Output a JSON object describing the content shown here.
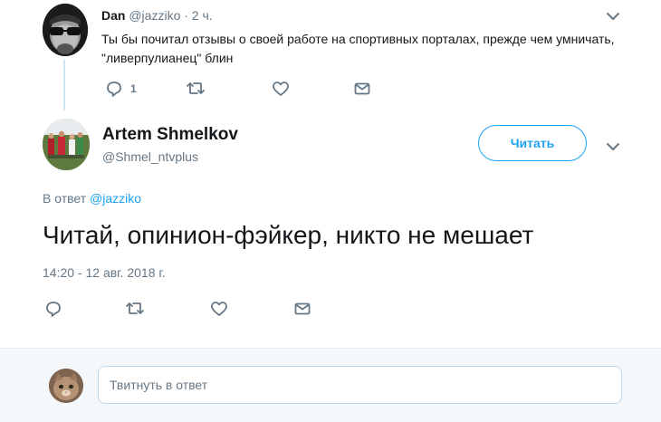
{
  "parent_tweet": {
    "author_name": "Dan",
    "handle": "@jazziko",
    "time": "· 2 ч.",
    "text": "Ты бы почитал отзывы о своей работе на спортивных порталах, прежде чем умничать, \"ливерпулианец\" блин",
    "reply_count": "1",
    "icons": [
      "reply-icon",
      "retweet-icon",
      "like-icon",
      "message-icon",
      "chevron-down-icon"
    ]
  },
  "main_tweet": {
    "author_name": "Artem Shmelkov",
    "handle": "@Shmel_ntvplus",
    "follow_label": "Читать",
    "reply_to_prefix": "В ответ",
    "reply_to_handle": "@jazziko",
    "text": "Читай, опинион-фэйкер, никто не мешает",
    "timestamp": "14:20 - 12 авг. 2018 г.",
    "icons": [
      "reply-icon",
      "retweet-icon",
      "like-icon",
      "message-icon",
      "chevron-down-icon"
    ]
  },
  "composer": {
    "placeholder": "Твитнуть в ответ"
  },
  "colors": {
    "accent": "#1da1f2",
    "secondary_text": "#657786",
    "thread_line": "#cce4f3",
    "composer_bg": "#f5f8fa"
  }
}
